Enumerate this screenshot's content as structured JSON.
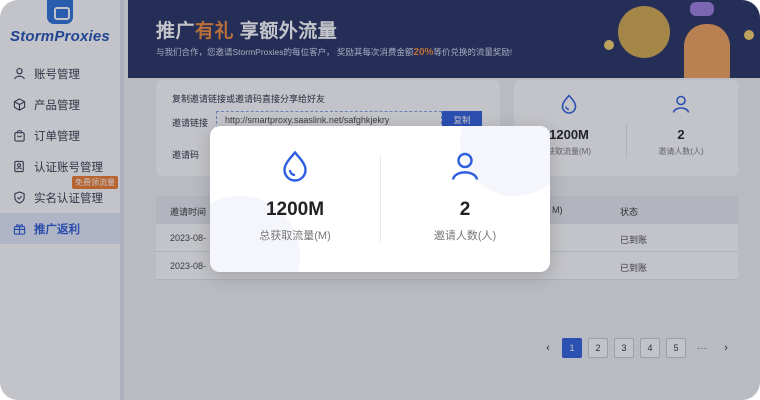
{
  "brand": {
    "name": "StormProxies"
  },
  "sidebar": {
    "items": [
      {
        "label": "账号管理",
        "icon": "user-icon"
      },
      {
        "label": "产品管理",
        "icon": "cube-icon"
      },
      {
        "label": "订单管理",
        "icon": "bag-icon"
      },
      {
        "label": "认证账号管理",
        "icon": "verified-account-icon"
      },
      {
        "label": "实名认证管理",
        "icon": "shield-icon",
        "badge": "免费领流量"
      },
      {
        "label": "推广返利",
        "icon": "gift-icon",
        "active": true
      }
    ]
  },
  "banner": {
    "title_prefix": "推广",
    "title_highlight": "有礼",
    "title_suffix": " 享额外流量",
    "subtitle_before": "与我们合作，您邀请StormProxies的每位客户， 奖励其每次消费金额",
    "subtitle_pct": "20%",
    "subtitle_after": "等价兑换的流量奖励!"
  },
  "invite": {
    "title": "复制邀请链接或邀请码直接分享给好友",
    "link_label": "邀请链接",
    "link_value": "http://smartproxy.saaslink.net/safghkjekry",
    "copy_button": "复制",
    "code_label": "邀请码"
  },
  "stats": {
    "traffic_value": "1200M",
    "traffic_label": "总获取流量(M)",
    "traffic_label_partial": "获取流量(M)",
    "invites_value": "2",
    "invites_label": "邀请人数(人)"
  },
  "table": {
    "headers": {
      "time": "邀请时间",
      "partial": "M)",
      "status": "状态"
    },
    "rows": [
      {
        "time": "2023-08-",
        "status": "已到账"
      },
      {
        "time": "2023-08-",
        "status": "已到账"
      }
    ]
  },
  "pagination": {
    "prev": "‹",
    "pages": [
      "1",
      "2",
      "3",
      "4",
      "5"
    ],
    "active_page": "1",
    "ellipsis": "···",
    "next": "›"
  },
  "colors": {
    "accent": "#2f5ee0",
    "banner_bg": "#243060",
    "highlight": "#f0893a"
  }
}
